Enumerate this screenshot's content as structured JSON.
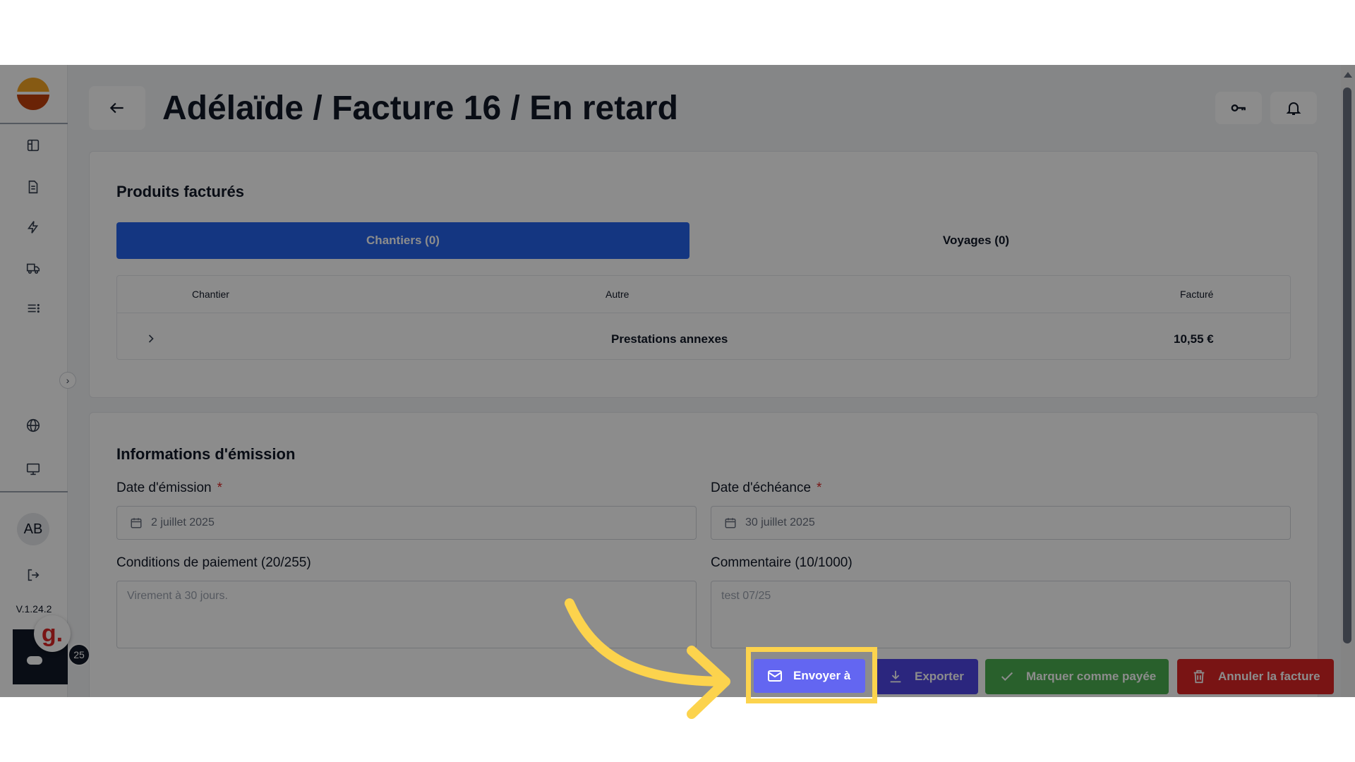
{
  "sidebar": {
    "avatar_initials": "AB",
    "version": "V.1.24.2",
    "widget_letter": "g.",
    "widget_badge": "25",
    "items": [
      {
        "name": "layout-icon"
      },
      {
        "name": "document-icon"
      },
      {
        "name": "bolt-icon"
      },
      {
        "name": "truck-icon"
      },
      {
        "name": "list-icon"
      },
      {
        "name": "globe-icon"
      },
      {
        "name": "monitor-icon"
      },
      {
        "name": "logout-icon"
      }
    ]
  },
  "header": {
    "title": "Adélaïde / Facture 16 / En retard"
  },
  "products": {
    "title": "Produits facturés",
    "tabs": [
      {
        "label": "Chantiers (0)",
        "active": true
      },
      {
        "label": "Voyages (0)",
        "active": false
      }
    ],
    "columns": [
      "Chantier",
      "Autre",
      "Facturé"
    ],
    "rows": [
      {
        "other": "Prestations annexes",
        "billed": "10,55 €"
      }
    ]
  },
  "emission": {
    "title": "Informations d'émission",
    "issue_date_label": "Date d'émission",
    "issue_date_value": "2 juillet 2025",
    "due_date_label": "Date d'échéance",
    "due_date_value": "30 juillet 2025",
    "required_mark": "*",
    "payment_terms_label": "Conditions de paiement (20/255)",
    "payment_terms_value": "Virement à 30 jours.",
    "comment_label": "Commentaire (10/1000)",
    "comment_value": "test 07/25"
  },
  "actions": {
    "send": "Envoyer à",
    "export": "Exporter",
    "mark_paid": "Marquer comme payée",
    "cancel": "Annuler la facture"
  },
  "colors": {
    "primary_blue": "#2563eb",
    "send_indigo": "#6366f1",
    "export_indigo": "#4f46e5",
    "paid_green": "#4caf50",
    "cancel_red": "#dc2626",
    "highlight_yellow": "#fcd34d"
  }
}
